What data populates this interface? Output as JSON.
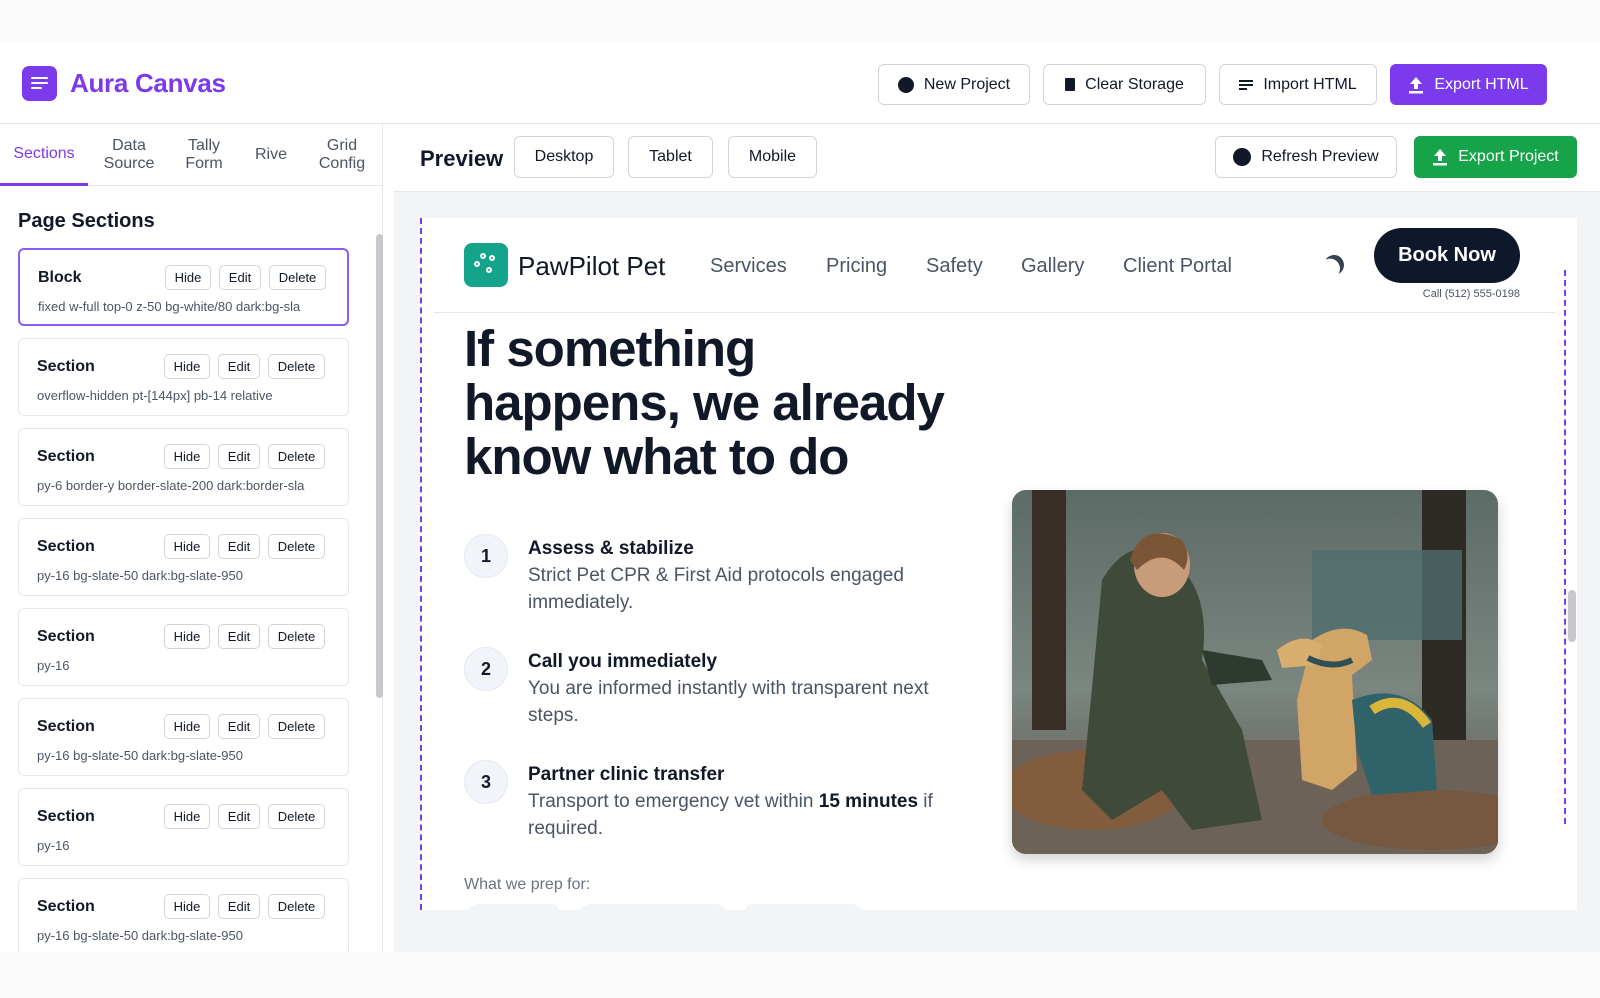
{
  "app": {
    "brand": "Aura Canvas",
    "colors": {
      "accent": "#7c3aed",
      "success": "#16a34a",
      "site_teal": "#14a38b"
    },
    "header_buttons": {
      "new_project": "New Project",
      "clear_storage": "Clear Storage",
      "import_html": "Import HTML",
      "export_html": "Export HTML"
    }
  },
  "sidebar": {
    "tabs": [
      {
        "label": "Sections",
        "active": true
      },
      {
        "label": "Data Source",
        "active": false
      },
      {
        "label": "Tally Form",
        "active": false
      },
      {
        "label": "Rive",
        "active": false
      },
      {
        "label": "Grid Config",
        "active": false
      }
    ],
    "title": "Page Sections",
    "action_labels": {
      "hide": "Hide",
      "edit": "Edit",
      "delete": "Delete"
    },
    "sections": [
      {
        "type": "Block",
        "classes": "fixed w-full top-0 z-50 bg-white/80 dark:bg-sla",
        "selected": true
      },
      {
        "type": "Section",
        "classes": "overflow-hidden pt-[144px] pb-14 relative",
        "selected": false
      },
      {
        "type": "Section",
        "classes": "py-6 border-y border-slate-200 dark:border-sla",
        "selected": false
      },
      {
        "type": "Section",
        "classes": "py-16 bg-slate-50 dark:bg-slate-950",
        "selected": false
      },
      {
        "type": "Section",
        "classes": "py-16",
        "selected": false
      },
      {
        "type": "Section",
        "classes": "py-16 bg-slate-50 dark:bg-slate-950",
        "selected": false
      },
      {
        "type": "Section",
        "classes": "py-16",
        "selected": false
      },
      {
        "type": "Section",
        "classes": "py-16 bg-slate-50 dark:bg-slate-950",
        "selected": false
      }
    ]
  },
  "preview": {
    "title": "Preview",
    "device_buttons": [
      "Desktop",
      "Tablet",
      "Mobile"
    ],
    "refresh_label": "Refresh Preview",
    "export_project_label": "Export Project"
  },
  "site": {
    "name": "PawPilot Pet",
    "nav": [
      "Services",
      "Pricing",
      "Safety",
      "Gallery",
      "Client Portal"
    ],
    "cta": "Book Now",
    "phone": "Call (512) 555-0198",
    "hero_title": "If something happens, we already know what to do",
    "steps": [
      {
        "num": "1",
        "title": "Assess & stabilize",
        "desc": "Strict Pet CPR & First Aid protocols engaged immediately."
      },
      {
        "num": "2",
        "title": "Call you immediately",
        "desc": "You are informed instantly with transparent next steps."
      },
      {
        "num": "3",
        "title": "Partner clinic transfer",
        "desc_before": "Transport to emergency vet within ",
        "desc_bold": "15 minutes",
        "desc_after": " if required."
      }
    ],
    "prep_label": "What we prep for:"
  }
}
